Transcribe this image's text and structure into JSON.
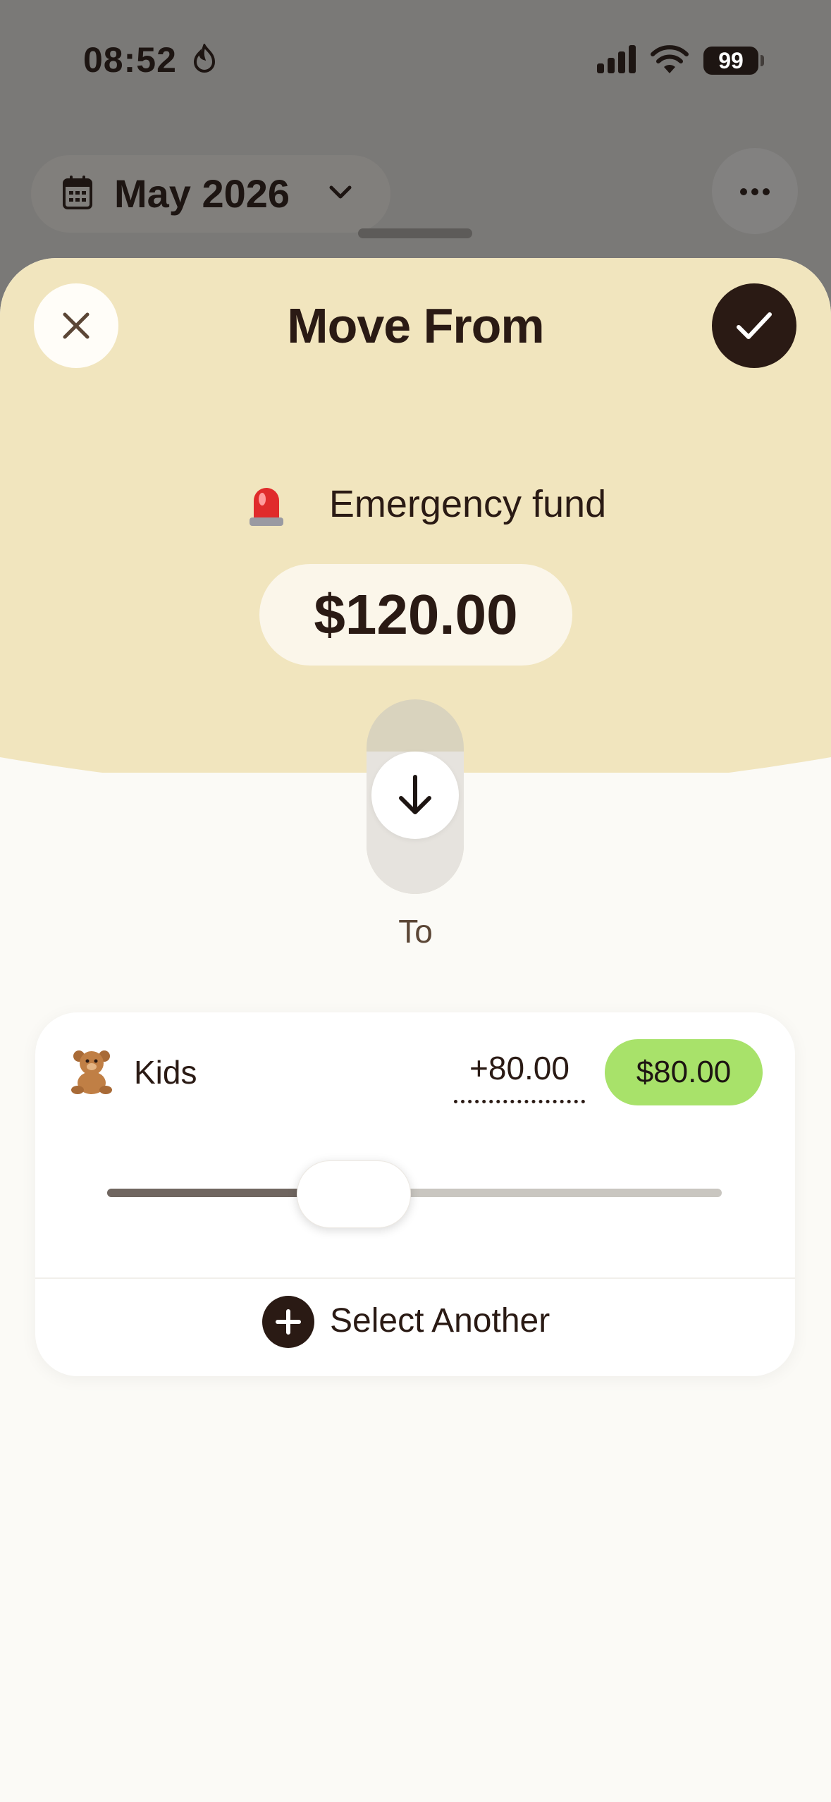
{
  "status_bar": {
    "time": "08:52",
    "battery": "99"
  },
  "header": {
    "month": "May 2026"
  },
  "sheet": {
    "title": "Move From",
    "source": {
      "name": "Emergency fund",
      "emoji": "🚨",
      "amount": "$120.00"
    },
    "to_label": "To"
  },
  "destination": {
    "name": "Kids",
    "emoji": "🧸",
    "delta": "+80.00",
    "balance": "$80.00",
    "slider_fraction": 0.4
  },
  "actions": {
    "select_another": "Select Another"
  },
  "colors": {
    "accent_green": "#a8e26a",
    "sheet_top": "#f1e5be",
    "dark": "#2a1a14"
  }
}
